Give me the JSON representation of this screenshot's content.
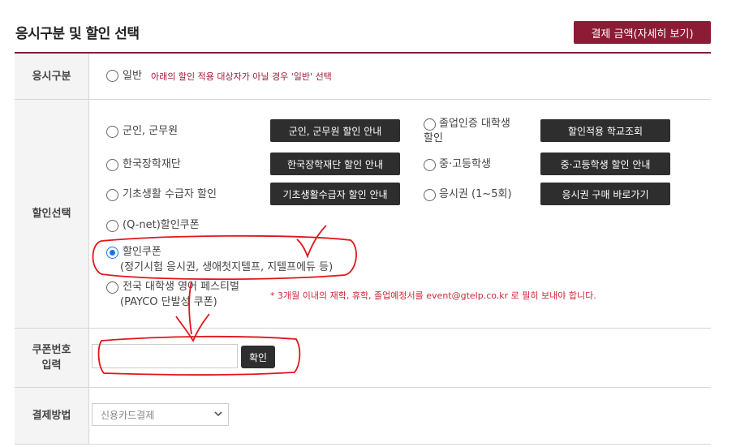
{
  "header": {
    "title": "응시구분 및 할인 선택",
    "pay_button": "결제 금액(자세히 보기)"
  },
  "rows": {
    "exam_type": {
      "label": "응시구분",
      "option": "일반",
      "notice": "아래의 할인 적용 대상자가 아닐 경우 '일반' 선택"
    },
    "discount": {
      "label": "할인선택",
      "options": {
        "military": "군인, 군무원",
        "graduate_line1": "졸업인증 대학생",
        "graduate_line2": "할인",
        "scholarship": "한국장학재단",
        "student": "중·고등학생",
        "welfare": "기초생활 수급자 할인",
        "ticket": "응시권 (1~5회)",
        "qnet": "(Q-net)할인쿠폰",
        "coupon_line1": "할인쿠폰",
        "coupon_line2": "(정기시험 응시권, 생애첫지텔프, 지텔프에듀 등)",
        "national_line1": "전국 대학생 영어 페스티벌",
        "national_line2": "(PAYCO 단발성 쿠폰)"
      },
      "buttons": {
        "military": "군인, 군무원 할인 안내",
        "school": "할인적용 학교조회",
        "scholarship": "한국장학재단 할인 안내",
        "student": "중·고등학생 할인 안내",
        "welfare": "기초생활수급자 할인 안내",
        "ticket": "응시권 구매 바로가기"
      },
      "notice": "* 3개월 이내의 재학, 휴학, 졸업예정서를 event@gtelp.co.kr 로 필히 보내야 합니다.",
      "selected": "할인쿠폰"
    },
    "coupon": {
      "label_line1": "쿠폰번호",
      "label_line2": "입력",
      "input_value": "",
      "confirm": "확인"
    },
    "payment": {
      "label": "결제방법",
      "selected": "신용카드결제"
    }
  },
  "colors": {
    "accent": "#8d1b35",
    "button_dark": "#2e2e2e",
    "annotation": "#e0161e"
  }
}
